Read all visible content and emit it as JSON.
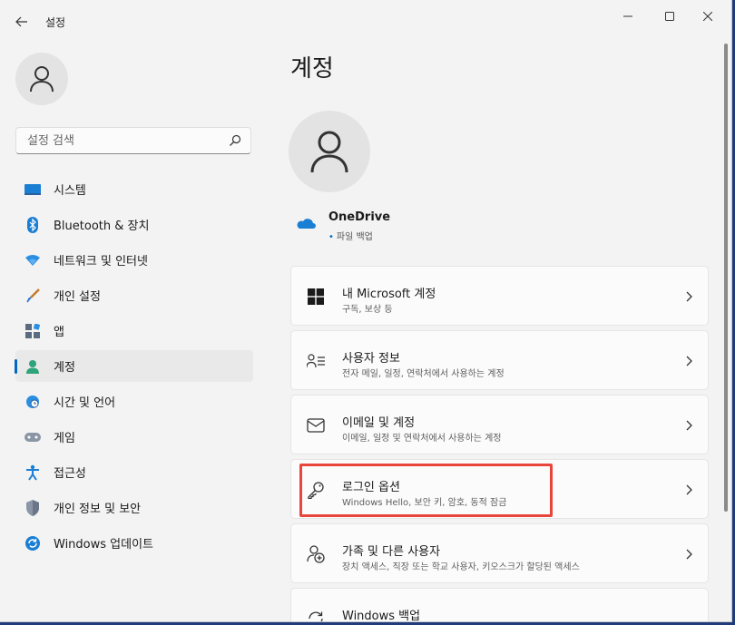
{
  "window": {
    "title": "설정"
  },
  "search": {
    "placeholder": "설정 검색"
  },
  "sidebar": {
    "items": [
      {
        "label": "시스템",
        "icon": "monitor-icon",
        "selected": false
      },
      {
        "label": "Bluetooth & 장치",
        "icon": "bluetooth-icon",
        "selected": false
      },
      {
        "label": "네트워크 및 인터넷",
        "icon": "wifi-icon",
        "selected": false
      },
      {
        "label": "개인 설정",
        "icon": "brush-icon",
        "selected": false
      },
      {
        "label": "앱",
        "icon": "apps-icon",
        "selected": false
      },
      {
        "label": "계정",
        "icon": "account-icon",
        "selected": true
      },
      {
        "label": "시간 및 언어",
        "icon": "globe-clock-icon",
        "selected": false
      },
      {
        "label": "게임",
        "icon": "gamepad-icon",
        "selected": false
      },
      {
        "label": "접근성",
        "icon": "accessibility-icon",
        "selected": false
      },
      {
        "label": "개인 정보 및 보안",
        "icon": "shield-icon",
        "selected": false
      },
      {
        "label": "Windows 업데이트",
        "icon": "update-icon",
        "selected": false
      }
    ]
  },
  "main": {
    "title": "계정",
    "onedrive": {
      "name": "OneDrive",
      "status": "파일 백업"
    },
    "cards": [
      {
        "title": "내 Microsoft 계정",
        "subtitle": "구독, 보상 등",
        "icon": "windows-logo-icon"
      },
      {
        "title": "사용자 정보",
        "subtitle": "전자 메일, 일정, 연락처에서 사용하는 계정",
        "icon": "user-info-icon"
      },
      {
        "title": "이메일 및 계정",
        "subtitle": "이메일, 일정 및 연락처에서 사용하는 계정",
        "icon": "mail-icon"
      },
      {
        "title": "로그인 옵션",
        "subtitle": "Windows Hello, 보안 키, 암호, 동적 잠금",
        "icon": "key-icon"
      },
      {
        "title": "가족 및 다른 사용자",
        "subtitle": "장치 액세스, 직장 또는 학교 사용자, 키오스크가 할당된 액세스",
        "icon": "family-icon"
      },
      {
        "title": "Windows 백업",
        "subtitle": "",
        "icon": "backup-icon"
      }
    ]
  },
  "colors": {
    "accent": "#0067c0",
    "highlight": "#e8463b"
  }
}
